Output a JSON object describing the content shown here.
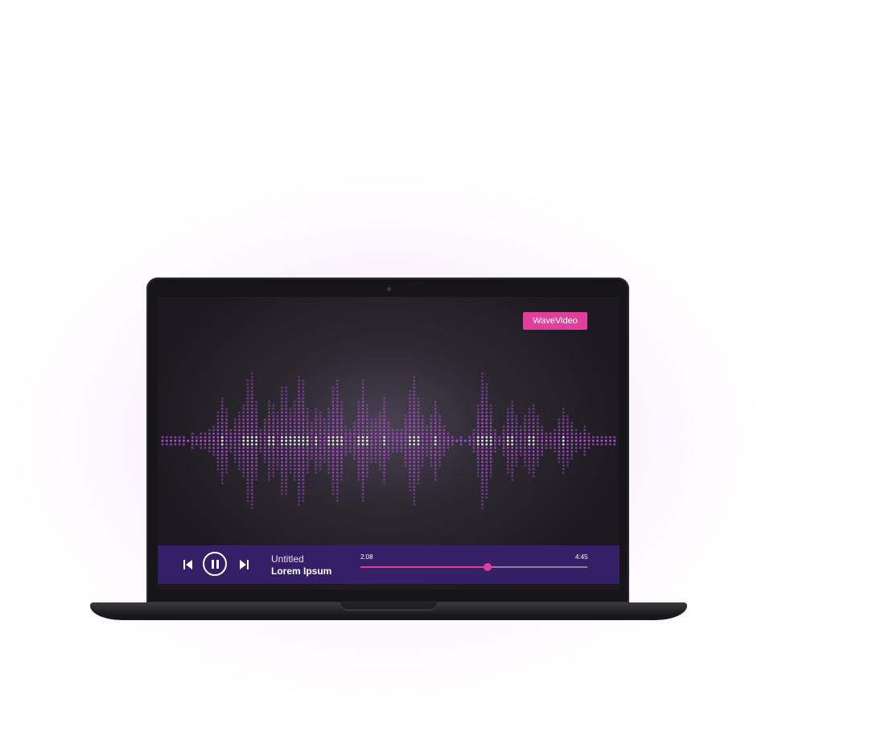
{
  "brand": {
    "label": "WaveVideo",
    "color": "#e0409c"
  },
  "player": {
    "title": "Untitled",
    "artist": "Lorem Ipsum",
    "elapsed": "2:08",
    "total": "4:45",
    "progress": 0.56,
    "controls": {
      "prev_icon": "skip-previous-icon",
      "play_icon": "pause-icon",
      "next_icon": "skip-next-icon"
    },
    "bar_color": "#352068"
  },
  "colors": {
    "accent": "#e0409c",
    "wave": "#b04fd4",
    "screen_bg": "#2d2932"
  }
}
